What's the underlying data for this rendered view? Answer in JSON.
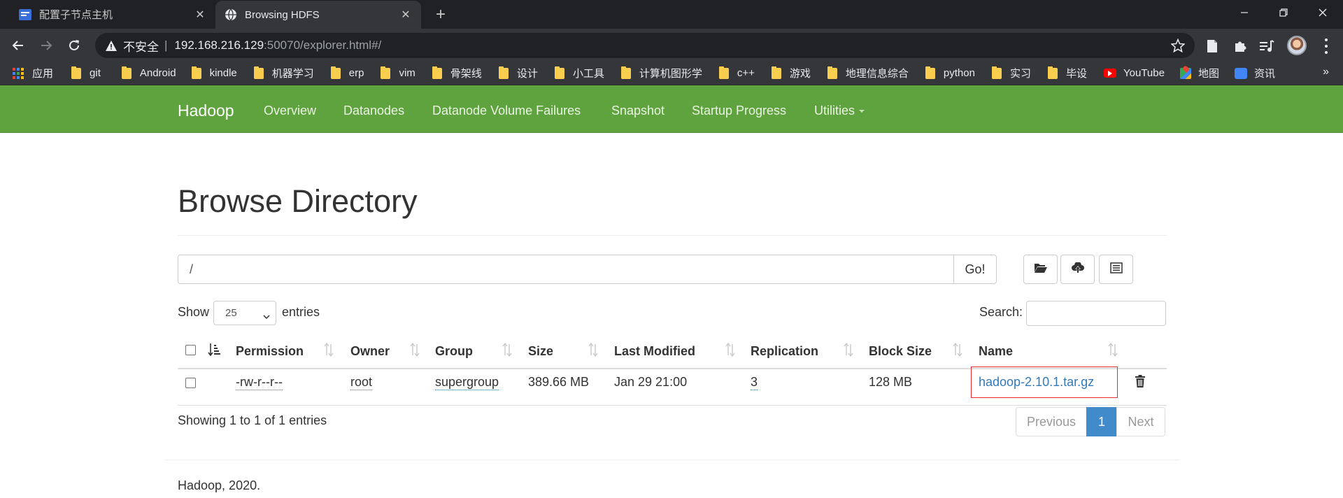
{
  "browser": {
    "tabs": [
      {
        "title": "配置子节点主机",
        "active": false
      },
      {
        "title": "Browsing HDFS",
        "active": true
      }
    ],
    "omnibox": {
      "insecure_label": "不安全",
      "separator": "|",
      "host": "192.168.216.129",
      "path": ":50070/explorer.html#/"
    },
    "bookmarks": [
      "应用",
      "git",
      "Android",
      "kindle",
      "机器学习",
      "erp",
      "vim",
      "骨架线",
      "设计",
      "小工具",
      "计算机图形学",
      "c++",
      "游戏",
      "地理信息综合",
      "python",
      "实习",
      "毕设",
      "YouTube",
      "地图",
      "资讯"
    ],
    "bookmarks_more": "»"
  },
  "navbar": {
    "brand": "Hadoop",
    "links": [
      "Overview",
      "Datanodes",
      "Datanode Volume Failures",
      "Snapshot",
      "Startup Progress",
      "Utilities"
    ]
  },
  "page": {
    "heading": "Browse Directory",
    "path_value": "/",
    "go_label": "Go!",
    "show_label": "Show",
    "entries_value": "25",
    "entries_label": "entries",
    "search_label": "Search:"
  },
  "table": {
    "headers": [
      "Permission",
      "Owner",
      "Group",
      "Size",
      "Last Modified",
      "Replication",
      "Block Size",
      "Name"
    ],
    "rows": [
      {
        "permission": "-rw-r--r--",
        "owner": "root",
        "group": "supergroup",
        "size": "389.66 MB",
        "last_modified": "Jan 29 21:00",
        "replication": "3",
        "block_size": "128 MB",
        "name": "hadoop-2.10.1.tar.gz"
      }
    ]
  },
  "pagination": {
    "info": "Showing 1 to 1 of 1 entries",
    "previous": "Previous",
    "current": "1",
    "next": "Next"
  },
  "footer": "Hadoop, 2020.",
  "colors": {
    "navbar_green": "#5fa33e",
    "link_blue": "#337ab7",
    "active_page": "#428bca",
    "highlight_red": "#e62e2e"
  }
}
